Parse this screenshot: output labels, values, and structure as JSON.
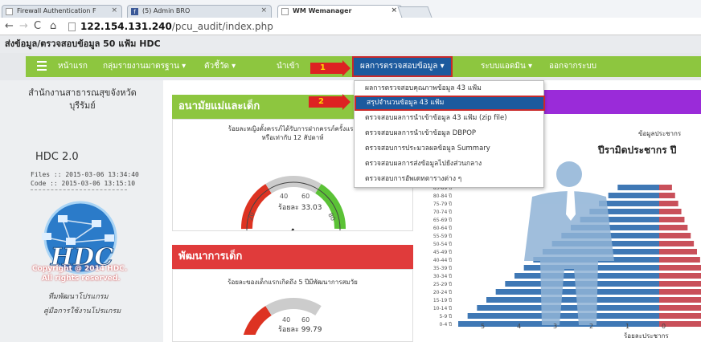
{
  "browser": {
    "tabs": [
      {
        "label": "Firewall Authentication F"
      },
      {
        "label": "(5) Admin BRO"
      },
      {
        "label": "WM Wemanager"
      }
    ],
    "url_host": "122.154.131.240",
    "url_path": "/pcu_audit/index.php"
  },
  "site": {
    "title": "ส่งข้อมูล/ตรวจสอบข้อมูล 50 แฟ้ม HDC"
  },
  "navbar": {
    "items": [
      {
        "label": "หน้าแรก"
      },
      {
        "label": "กลุ่มรายงานมาตรฐาน ▾"
      },
      {
        "label": "ตัวชี้วัด ▾"
      },
      {
        "label": "นำเข้า"
      },
      {
        "label": "ผลการตรวจสอบข้อมูล ▾"
      },
      {
        "label": "ระบบแอดมิน ▾"
      },
      {
        "label": "ออกจากระบบ"
      }
    ]
  },
  "dropdown": {
    "items": [
      {
        "label": "ผลการตรวจสอบคุณภาพข้อมูล 43 แฟ้ม"
      },
      {
        "label": "สรุปจำนวนข้อมูล 43 แฟ้ม"
      },
      {
        "label": "ตรวจสอบผลการนำเข้าข้อมูล 43 แฟ้ม (zip file)"
      },
      {
        "label": "ตรวจสอบผลการนำเข้าข้อมูล DBPOP"
      },
      {
        "label": "ตรวจสอบการประมวลผลข้อมูล Summary"
      },
      {
        "label": "ตรวจสอบผลการส่งข้อมูลไปยังส่วนกลาง"
      },
      {
        "label": "ตรวจสอบการอัพเดทตารางต่าง ๆ"
      }
    ]
  },
  "callouts": {
    "one": "1",
    "two": "2"
  },
  "sidebar": {
    "org_line1": "สำนักงานสาธารณสุขจังหวัด",
    "org_line2": "บุรีรัมย์",
    "app_name": "HDC 2.0",
    "files_label": "Files :: 2015-03-06 13:34:40",
    "code_label": "Code :: 2015-03-06 13:15:10",
    "logo_text": "HDC",
    "copyright_line1": "Copyright @ 2014 HDC.",
    "copyright_line2": "All rights reserved.",
    "link_dev": "ทีมพัฒนาโปรแกรม",
    "link_manual": "คู่มือการใช้งานโปรแกรม"
  },
  "panels": {
    "maternal": {
      "title": "อนามัยแม่และเด็ก",
      "desc_line1": "ร้อยละหญิงตั้งครรภ์ได้รับการฝากครรภ์ครั้งแรก",
      "desc_line2": "หรือเท่ากับ 12 สัปดาห์",
      "gauge_value_label": "ร้อยละ 33.03",
      "gauge_value": 33.03,
      "ticks": [
        "0",
        "20",
        "40",
        "60",
        "80",
        "100"
      ]
    },
    "child": {
      "title": "พัฒนาการเด็ก",
      "desc": "ร้อยละของเด็กแรกเกิดถึง 5 ปีมีพัฒนาการสมวัย",
      "gauge_value_label": "ร้อยละ 99.79",
      "gauge_value": 99.79,
      "ticks": [
        "40",
        "60"
      ]
    }
  },
  "right": {
    "subtitle": "ข้อมูลประชากร",
    "title": "ปีรามิดประชากร ปี",
    "age_groups": [
      "85-89 ปี",
      "80-84 ปี",
      "75-79 ปี",
      "70-74 ปี",
      "65-69 ปี",
      "60-64 ปี",
      "55-59 ปี",
      "50-54 ปี",
      "45-49 ปี",
      "40-44 ปี",
      "35-39 ปี",
      "30-34 ปี",
      "25-29 ปี",
      "20-24 ปี",
      "15-19 ปี",
      "10-14 ปี",
      "5-9 ปี",
      "0-4 ปี"
    ],
    "x_ticks": [
      "5",
      "4",
      "3",
      "2",
      "1",
      "0"
    ],
    "xlabel": "ร้อยละประชากร"
  },
  "colors": {
    "green": "#8dc63f",
    "blue": "#1c5a9e",
    "red": "#e03b3b",
    "purple": "#9a2bd9"
  }
}
